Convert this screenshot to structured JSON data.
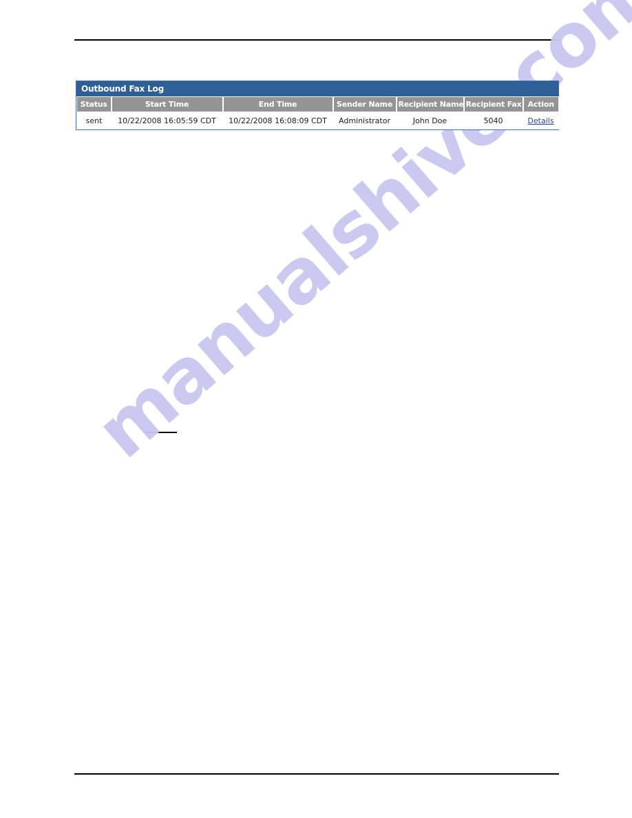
{
  "page": {
    "rules": {
      "top_label": "header-rule",
      "bottom_label": "footer-rule"
    },
    "watermark": {
      "text": "manualshive.com",
      "color": "#c9c7ef"
    },
    "stray_mark_label": "underline-mark"
  },
  "panel": {
    "title": "Outbound Fax Log",
    "title_bg": "#2e5f96",
    "header_bg": "#949494",
    "link_color": "#2a4b7c",
    "columns": [
      {
        "key": "status",
        "label": "Status"
      },
      {
        "key": "start",
        "label": "Start Time"
      },
      {
        "key": "end",
        "label": "End Time"
      },
      {
        "key": "sender",
        "label": "Sender Name"
      },
      {
        "key": "recipient",
        "label": "Recipient Name"
      },
      {
        "key": "fax",
        "label": "Recipient Fax"
      },
      {
        "key": "action",
        "label": "Action"
      }
    ],
    "rows": [
      {
        "status": "sent",
        "start": "10/22/2008 16:05:59 CDT",
        "end": "10/22/2008 16:08:09 CDT",
        "sender": "Administrator",
        "recipient": "John Doe",
        "fax": "5040",
        "action": "Details"
      }
    ]
  }
}
